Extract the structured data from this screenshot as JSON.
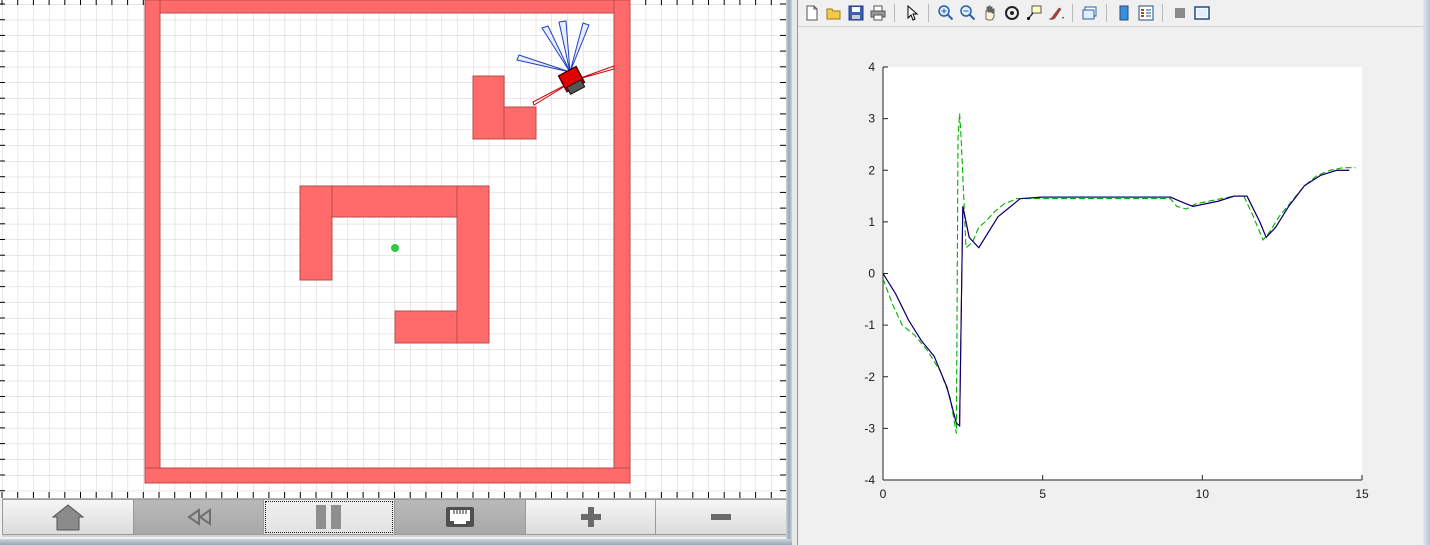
{
  "simulator": {
    "controls": [
      {
        "name": "home-button",
        "icon": "home-icon"
      },
      {
        "name": "rewind-button",
        "icon": "rewind-icon"
      },
      {
        "name": "pause-button",
        "icon": "pause-icon"
      },
      {
        "name": "network-button",
        "icon": "ethernet-icon"
      },
      {
        "name": "zoom-in-button",
        "icon": "plus-icon"
      },
      {
        "name": "zoom-out-button",
        "icon": "minus-icon"
      }
    ],
    "colors": {
      "wall": "#ff6b6b",
      "wall_edge": "#b84848",
      "grid": "#cfcfcf",
      "goal": "#2ecc40",
      "robot": "#e00000",
      "ir_sensor": "#1f3fbf",
      "range_sensor": "#d00000"
    }
  },
  "figure": {
    "toolbar": [
      "new-figure-icon",
      "open-file-icon",
      "save-icon",
      "print-icon",
      "pointer-icon",
      "zoom-in-icon",
      "zoom-out-icon",
      "pan-hand-icon",
      "rotate-3d-icon",
      "data-cursor-icon",
      "brush-icon",
      "link-plot-icon",
      "colorbar-icon",
      "legend-icon",
      "hide-plot-tools-icon",
      "show-plot-tools-icon"
    ]
  },
  "chart_data": {
    "type": "line",
    "title": "",
    "xlabel": "",
    "ylabel": "",
    "xlim": [
      0,
      15
    ],
    "ylim": [
      -4,
      4
    ],
    "x_ticks": [
      "0",
      "5",
      "10",
      "15"
    ],
    "y_ticks": [
      "4",
      "3",
      "2",
      "1",
      "0",
      "-1",
      "-2",
      "-3",
      "-4"
    ],
    "grid": false,
    "series": [
      {
        "color": "#00b000",
        "style": "dashed",
        "x": [
          0,
          0.3,
          0.6,
          1.0,
          1.4,
          1.8,
          2.1,
          2.3,
          2.35,
          2.4,
          2.45,
          2.6,
          2.8,
          3.0,
          3.2,
          3.5,
          3.8,
          4.0,
          4.2,
          5,
          6,
          7,
          8,
          9,
          9.2,
          9.5,
          9.8,
          10.2,
          10.6,
          11,
          11.3,
          11.6,
          11.9,
          12.1,
          12.4,
          12.8,
          13.2,
          13.6,
          14.0,
          14.4,
          14.8
        ],
        "y": [
          -0.1,
          -0.6,
          -1.0,
          -1.2,
          -1.5,
          -1.9,
          -2.4,
          -3.1,
          2.6,
          3.1,
          2.6,
          0.5,
          0.6,
          0.9,
          1.0,
          1.2,
          1.35,
          1.4,
          1.45,
          1.45,
          1.45,
          1.45,
          1.45,
          1.45,
          1.3,
          1.25,
          1.35,
          1.4,
          1.45,
          1.5,
          1.5,
          1.1,
          0.65,
          0.8,
          1.1,
          1.4,
          1.7,
          1.9,
          2.0,
          2.05,
          2.05
        ]
      },
      {
        "color": "#c00000",
        "style": "solid",
        "x": [
          0,
          0.4,
          0.8,
          1.2,
          1.6,
          2.0,
          2.3,
          2.4,
          2.5,
          2.7,
          3.0,
          3.3,
          3.6,
          4.0,
          4.3,
          5,
          6,
          7,
          8,
          9,
          9.3,
          9.7,
          10.1,
          10.5,
          11,
          11.4,
          11.8,
          12.0,
          12.3,
          12.7,
          13.2,
          13.7,
          14.2,
          14.6
        ],
        "y": [
          0,
          -0.4,
          -0.9,
          -1.3,
          -1.6,
          -2.2,
          -2.9,
          -2.95,
          1.3,
          0.7,
          0.5,
          0.8,
          1.1,
          1.3,
          1.45,
          1.48,
          1.48,
          1.48,
          1.48,
          1.48,
          1.4,
          1.3,
          1.35,
          1.4,
          1.5,
          1.5,
          1.0,
          0.7,
          0.9,
          1.3,
          1.7,
          1.9,
          2.0,
          2.0
        ]
      },
      {
        "color": "#000080",
        "style": "solid",
        "x": [
          0,
          0.4,
          0.8,
          1.2,
          1.6,
          2.0,
          2.3,
          2.4,
          2.5,
          2.7,
          3.0,
          3.3,
          3.6,
          4.0,
          4.3,
          5,
          6,
          7,
          8,
          9,
          9.3,
          9.7,
          10.1,
          10.5,
          11,
          11.4,
          11.8,
          12.0,
          12.3,
          12.7,
          13.2,
          13.7,
          14.2,
          14.6
        ],
        "y": [
          0,
          -0.4,
          -0.9,
          -1.3,
          -1.6,
          -2.2,
          -2.9,
          -2.95,
          1.3,
          0.7,
          0.5,
          0.8,
          1.1,
          1.3,
          1.45,
          1.48,
          1.48,
          1.48,
          1.48,
          1.48,
          1.4,
          1.3,
          1.35,
          1.4,
          1.5,
          1.5,
          1.0,
          0.7,
          0.9,
          1.3,
          1.7,
          1.9,
          2.0,
          2.0
        ]
      }
    ]
  }
}
